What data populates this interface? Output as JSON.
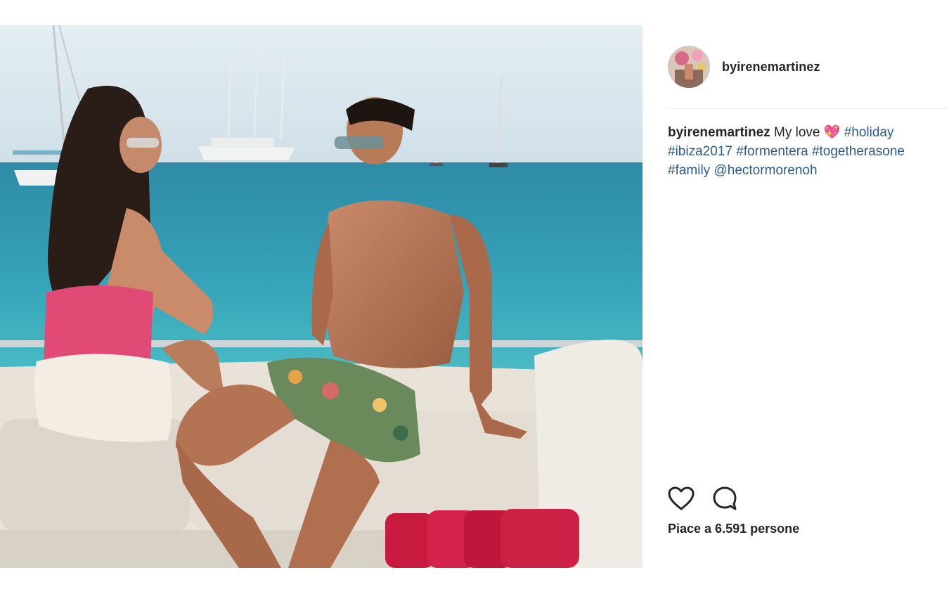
{
  "post": {
    "username": "byirenemartinez",
    "caption": {
      "user": "byirenemartinez",
      "text": "My love",
      "emoji": "💖",
      "hashtags": [
        "#holiday",
        "#ibiza2017",
        "#formentera",
        "#togetherasone",
        "#family"
      ],
      "mention": "@hectormorenoh"
    },
    "likes_text": "Piace a 6.591 persone"
  },
  "icons": {
    "like": "heart-icon",
    "comment": "comment-icon"
  },
  "colors": {
    "text": "#262626",
    "link": "#2c5a8c",
    "divider": "#efefef"
  }
}
